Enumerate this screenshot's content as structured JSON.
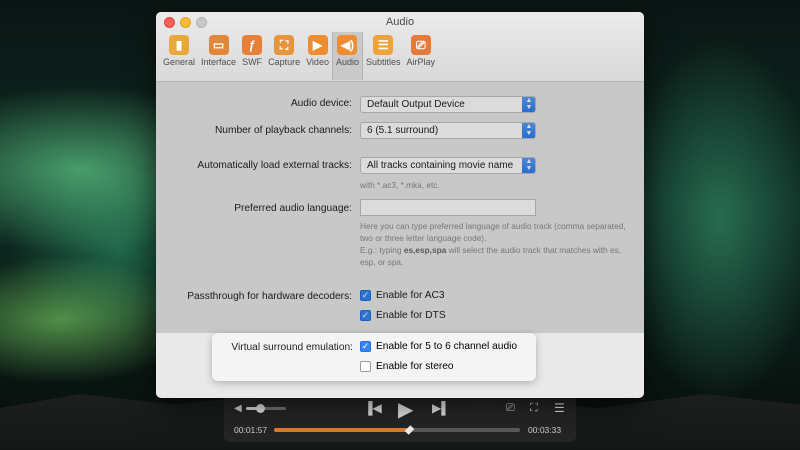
{
  "window": {
    "title": "Audio",
    "toolbar": [
      {
        "label": "General",
        "icon": "general-icon",
        "color": "#e8a93a",
        "glyph": "▮"
      },
      {
        "label": "Interface",
        "icon": "interface-icon",
        "color": "#e0873a",
        "glyph": "▭"
      },
      {
        "label": "SWF",
        "icon": "swf-icon",
        "color": "#e5813b",
        "glyph": "ƒ"
      },
      {
        "label": "Capture",
        "icon": "capture-icon",
        "color": "#e7953d",
        "glyph": "⛶"
      },
      {
        "label": "Video",
        "icon": "video-icon",
        "color": "#ee8d2f",
        "glyph": "▶"
      },
      {
        "label": "Audio",
        "icon": "audio-icon",
        "color": "#ee8d2f",
        "glyph": "◀)"
      },
      {
        "label": "Subtitles",
        "icon": "subtitles-icon",
        "color": "#f0a23c",
        "glyph": "☰"
      },
      {
        "label": "AirPlay",
        "icon": "airplay-icon",
        "color": "#e57a3b",
        "glyph": "⎚"
      }
    ],
    "active_tab": "Audio"
  },
  "settings": {
    "audio_device": {
      "label": "Audio device:",
      "value": "Default Output Device"
    },
    "channels": {
      "label": "Number of playback channels:",
      "value": "6 (5.1 surround)"
    },
    "external_tracks": {
      "label": "Automatically load external tracks:",
      "value": "All tracks containing movie name",
      "hint": "with *.ac3, *.mka, etc."
    },
    "preferred_language": {
      "label": "Preferred audio language:",
      "value": "",
      "hint1": "Here you can type preferred language of audio track (comma separated, two or three letter language code).",
      "hint2_prefix": "E.g.: typing ",
      "hint2_code": "es,esp,spa",
      "hint2_suffix": " will select the audio track that matches with es, esp, or spa."
    },
    "passthrough": {
      "label": "Passthrough for hardware decoders:",
      "ac3": {
        "label": "Enable for AC3",
        "checked": true
      },
      "dts": {
        "label": "Enable for DTS",
        "checked": true
      }
    },
    "virtual_surround": {
      "label": "Virtual surround emulation:",
      "six_channel": {
        "label": "Enable for 5 to 6 channel audio",
        "checked": true
      },
      "stereo": {
        "label": "Enable for stereo",
        "checked": false
      }
    }
  },
  "player": {
    "elapsed": "00:01:57",
    "remaining": "00:03:33",
    "progress_fraction": 0.55,
    "volume_fraction": 0.35
  },
  "colors": {
    "accent": "#3486f5",
    "progress": "#e07a2b"
  }
}
